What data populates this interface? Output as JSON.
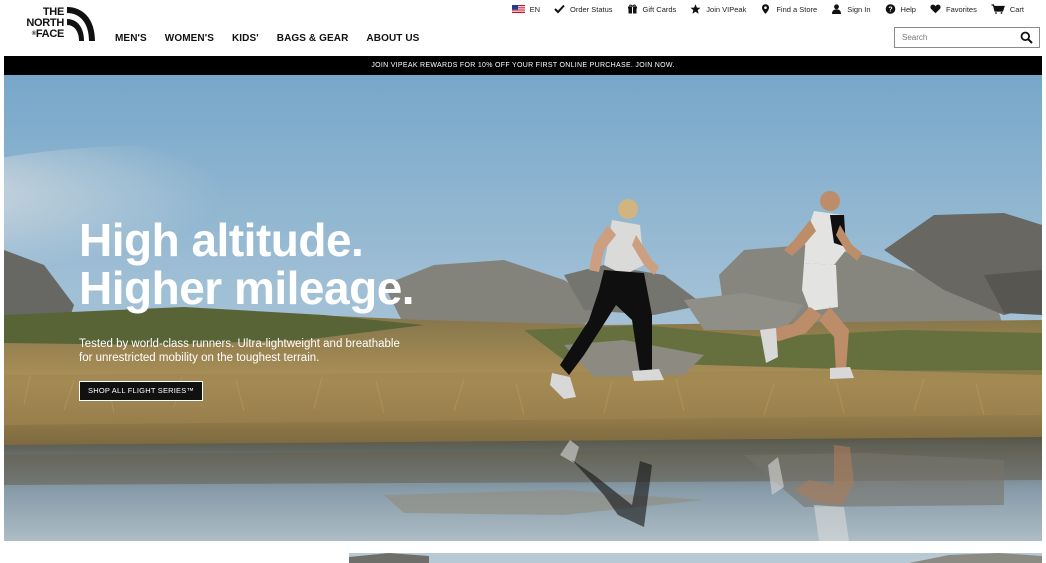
{
  "header": {
    "logo": {
      "line1": "THE",
      "line2": "NORTH",
      "line3": "FACE",
      "registered": "®"
    },
    "main_nav": [
      "MEN'S",
      "WOMEN'S",
      "KIDS'",
      "BAGS & GEAR",
      "ABOUT US"
    ],
    "utility": {
      "language": "EN",
      "order_status": "Order Status",
      "gift_cards": "Gift Cards",
      "join_vipeak": "Join VIPeak",
      "find_store": "Find a Store",
      "sign_in": "Sign In",
      "help": "Help",
      "favorites": "Favorites",
      "cart": "Cart"
    },
    "search": {
      "placeholder": "Search"
    }
  },
  "promo": {
    "text": "JOIN VIPEAK REWARDS FOR 10% OFF YOUR FIRST ONLINE PURCHASE. JOIN NOW."
  },
  "hero": {
    "title_line1": "High altitude.",
    "title_line2": "Higher mileage.",
    "subtitle_line1": "Tested by world-class runners. Ultra-lightweight and breathable",
    "subtitle_line2": "for unrestricted mobility on the toughest terrain.",
    "cta": "SHOP ALL FLIGHT SERIES™"
  },
  "colors": {
    "black": "#000000",
    "white": "#ffffff",
    "flag_red": "#c8102e",
    "flag_blue": "#1c3f94"
  }
}
